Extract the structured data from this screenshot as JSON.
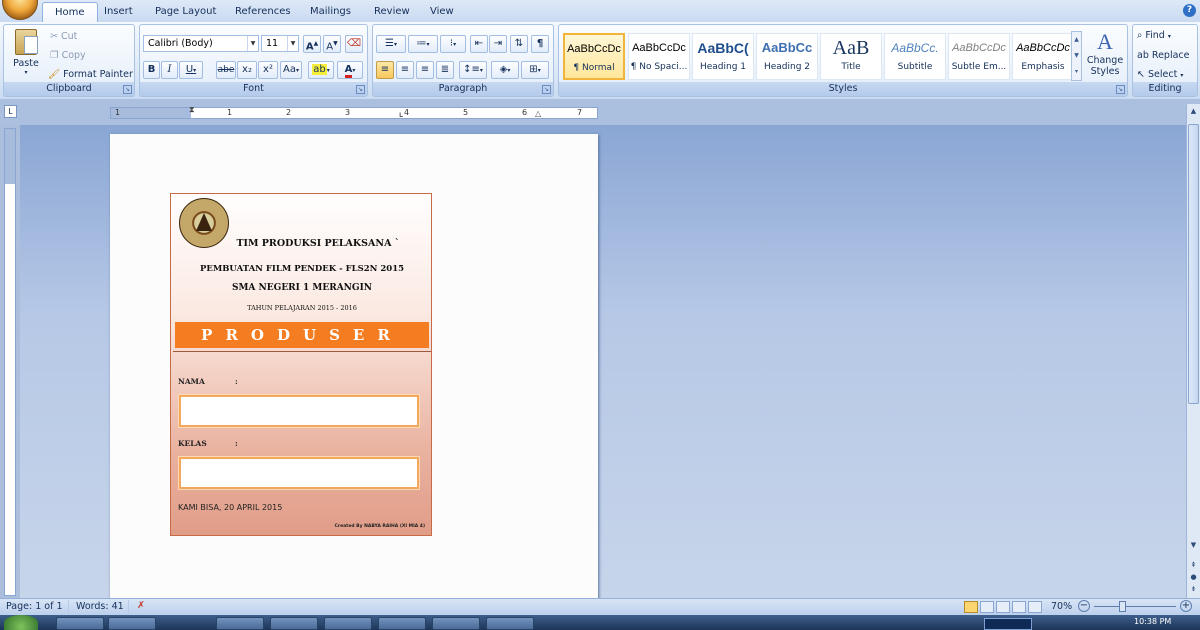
{
  "tabs": [
    {
      "label": "Home",
      "active": true
    },
    {
      "label": "Insert"
    },
    {
      "label": "Page Layout"
    },
    {
      "label": "References"
    },
    {
      "label": "Mailings"
    },
    {
      "label": "Review"
    },
    {
      "label": "View"
    }
  ],
  "clipboard": {
    "paste": "Paste",
    "cut": "Cut",
    "copy": "Copy",
    "format_painter": "Format Painter",
    "label": "Clipboard"
  },
  "font": {
    "name": "Calibri (Body)",
    "size": "11",
    "label": "Font",
    "grow": "A",
    "shrink": "A",
    "bold": "B",
    "italic": "I",
    "underline": "U",
    "strike": "abe",
    "sub": "x₂",
    "sup": "x²",
    "case": "Aa",
    "highlight": "ab",
    "color": "A"
  },
  "paragraph": {
    "label": "Paragraph",
    "pilcrow": "¶"
  },
  "styles": {
    "label": "Styles",
    "items": [
      {
        "sample": "AaBbCcDc",
        "name": "¶ Normal",
        "selected": true
      },
      {
        "sample": "AaBbCcDc",
        "name": "¶ No Spaci..."
      },
      {
        "sample": "AaBbC(",
        "name": "Heading 1"
      },
      {
        "sample": "AaBbCc",
        "name": "Heading 2"
      },
      {
        "sample": "AaB",
        "name": "Title"
      },
      {
        "sample": "AaBbCc.",
        "name": "Subtitle"
      },
      {
        "sample": "AaBbCcDc",
        "name": "Subtle Em..."
      },
      {
        "sample": "AaBbCcDc",
        "name": "Emphasis"
      }
    ],
    "change_styles": "Change Styles"
  },
  "editing": {
    "label": "Editing",
    "find": "Find",
    "replace": "Replace",
    "select": "Select"
  },
  "ruler": {
    "numbers": [
      "1",
      "1",
      "2",
      "3",
      "4",
      "5",
      "6",
      "7"
    ]
  },
  "document": {
    "title": "TIM PRODUKSI PELAKSANA `",
    "line2": "PEMBUATAN FILM PENDEK - FLS2N 2015",
    "school": "SMA NEGERI 1 MERANGIN",
    "year": "TAHUN PELAJARAN 2015 - 2016",
    "banner": "PRODUSER",
    "nama_label": "NAMA",
    "colon": ":",
    "kelas_label": "KELAS",
    "motto": "KAMI BISA, 20 APRIL 2015",
    "credit": "Created By NABYA RAIHA (XI MIA 4)"
  },
  "status": {
    "page": "Page: 1 of 1",
    "words": "Words: 41",
    "zoom": "70%"
  },
  "taskbar": {
    "time": "10:38 PM"
  }
}
